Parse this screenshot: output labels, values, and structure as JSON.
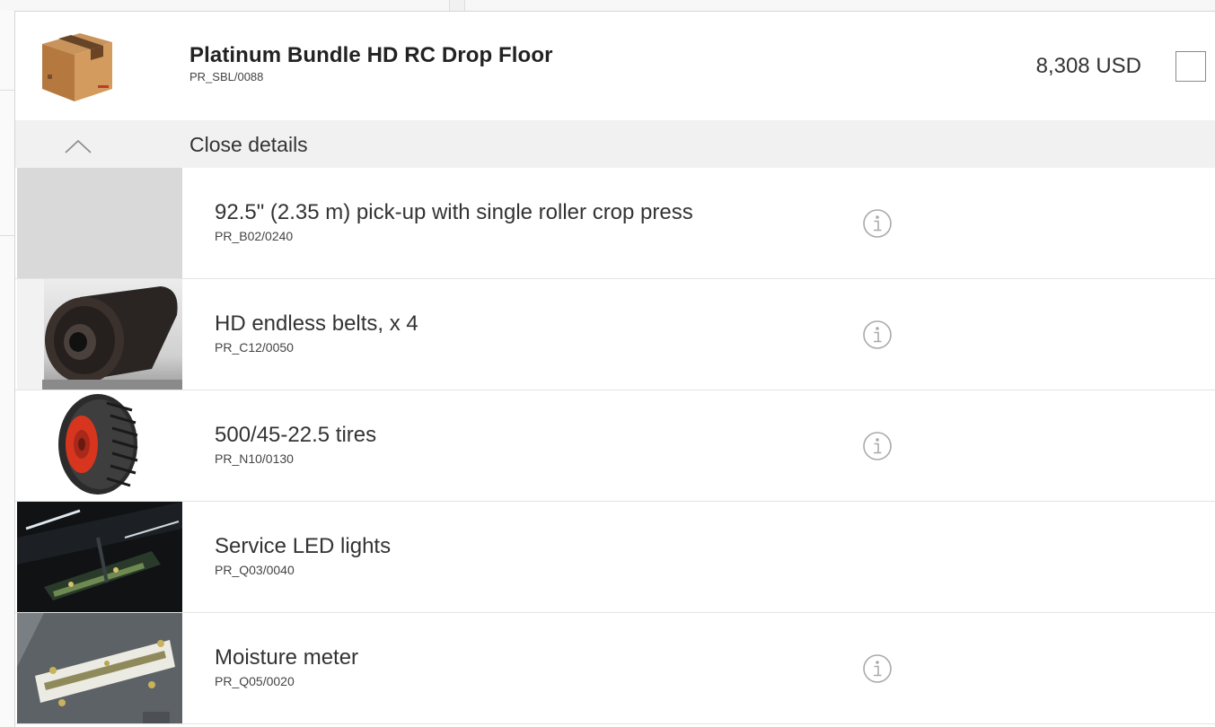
{
  "header": {
    "title": "Platinum Bundle HD RC Drop Floor",
    "code": "PR_SBL/0088",
    "price": "8,308 USD"
  },
  "details": {
    "toggle_label": "Close details"
  },
  "items": [
    {
      "name": "92.5\" (2.35 m) pick-up with single roller crop press",
      "code": "PR_B02/0240",
      "thumb": "placeholder",
      "has_info": true
    },
    {
      "name": "HD endless belts, x 4",
      "code": "PR_C12/0050",
      "thumb": "belt-roll",
      "has_info": true
    },
    {
      "name": "500/45-22.5 tires",
      "code": "PR_N10/0130",
      "thumb": "tire",
      "has_info": true
    },
    {
      "name": "Service LED lights",
      "code": "PR_Q03/0040",
      "thumb": "led-lights",
      "has_info": false
    },
    {
      "name": "Moisture meter",
      "code": "PR_Q05/0020",
      "thumb": "moisture-sensor",
      "has_info": true
    }
  ],
  "icons": {
    "product": "cardboard-box-icon",
    "collapse": "chevron-up-icon",
    "info": "info-icon",
    "select": "checkbox"
  },
  "colors": {
    "details_bar": "#f1f1f1",
    "info_icon": "#aaaaaa",
    "border": "#e4e4e4"
  }
}
